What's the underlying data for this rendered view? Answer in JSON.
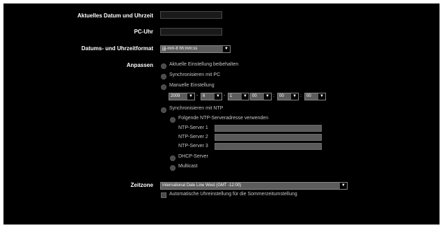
{
  "fields": {
    "datetime_label": "Aktuelles Datum und Uhrzeit",
    "datetime_value": "",
    "pc_clock_label": "PC-Uhr",
    "pc_clock_value": "",
    "format_label": "Datums- und Uhrzeitformat",
    "format_value": "jjjj-mm-tt hh:mm:ss"
  },
  "adjust": {
    "label": "Anpassen",
    "options": {
      "keep": "Aktuelle Einstellung beibehalten",
      "sync_pc": "Synchronisieren mit PC",
      "manual": "Manuelle Einstellung",
      "sync_ntp": "Synchronisieren mit NTP"
    },
    "manual": {
      "year": "2009",
      "month": "6",
      "day": "1",
      "hour": "00",
      "minute": "00",
      "second": "00",
      "date_sep": "-",
      "time_sep": ":"
    },
    "ntp": {
      "use_addresses": "Folgende NTP-Serveradresse verwenden",
      "server1_label": "NTP-Server 1",
      "server2_label": "NTP-Server 2",
      "server3_label": "NTP-Server 3",
      "dhcp": "DHCP-Server",
      "multicast": "Multicast"
    }
  },
  "timezone": {
    "label": "Zeitzone",
    "value": "International Date Line West (GMT -12:00)",
    "dst_label": "Automatische Uhreinstellung für die Sommerzeitumstellung"
  },
  "icons": {
    "dropdown": "▼"
  },
  "colors": {
    "background": "#000000",
    "label": "#ffffff",
    "option_text": "#c8c8c8",
    "select_bg": "#5c5c5c",
    "input_bg": "#1a1a1a"
  }
}
